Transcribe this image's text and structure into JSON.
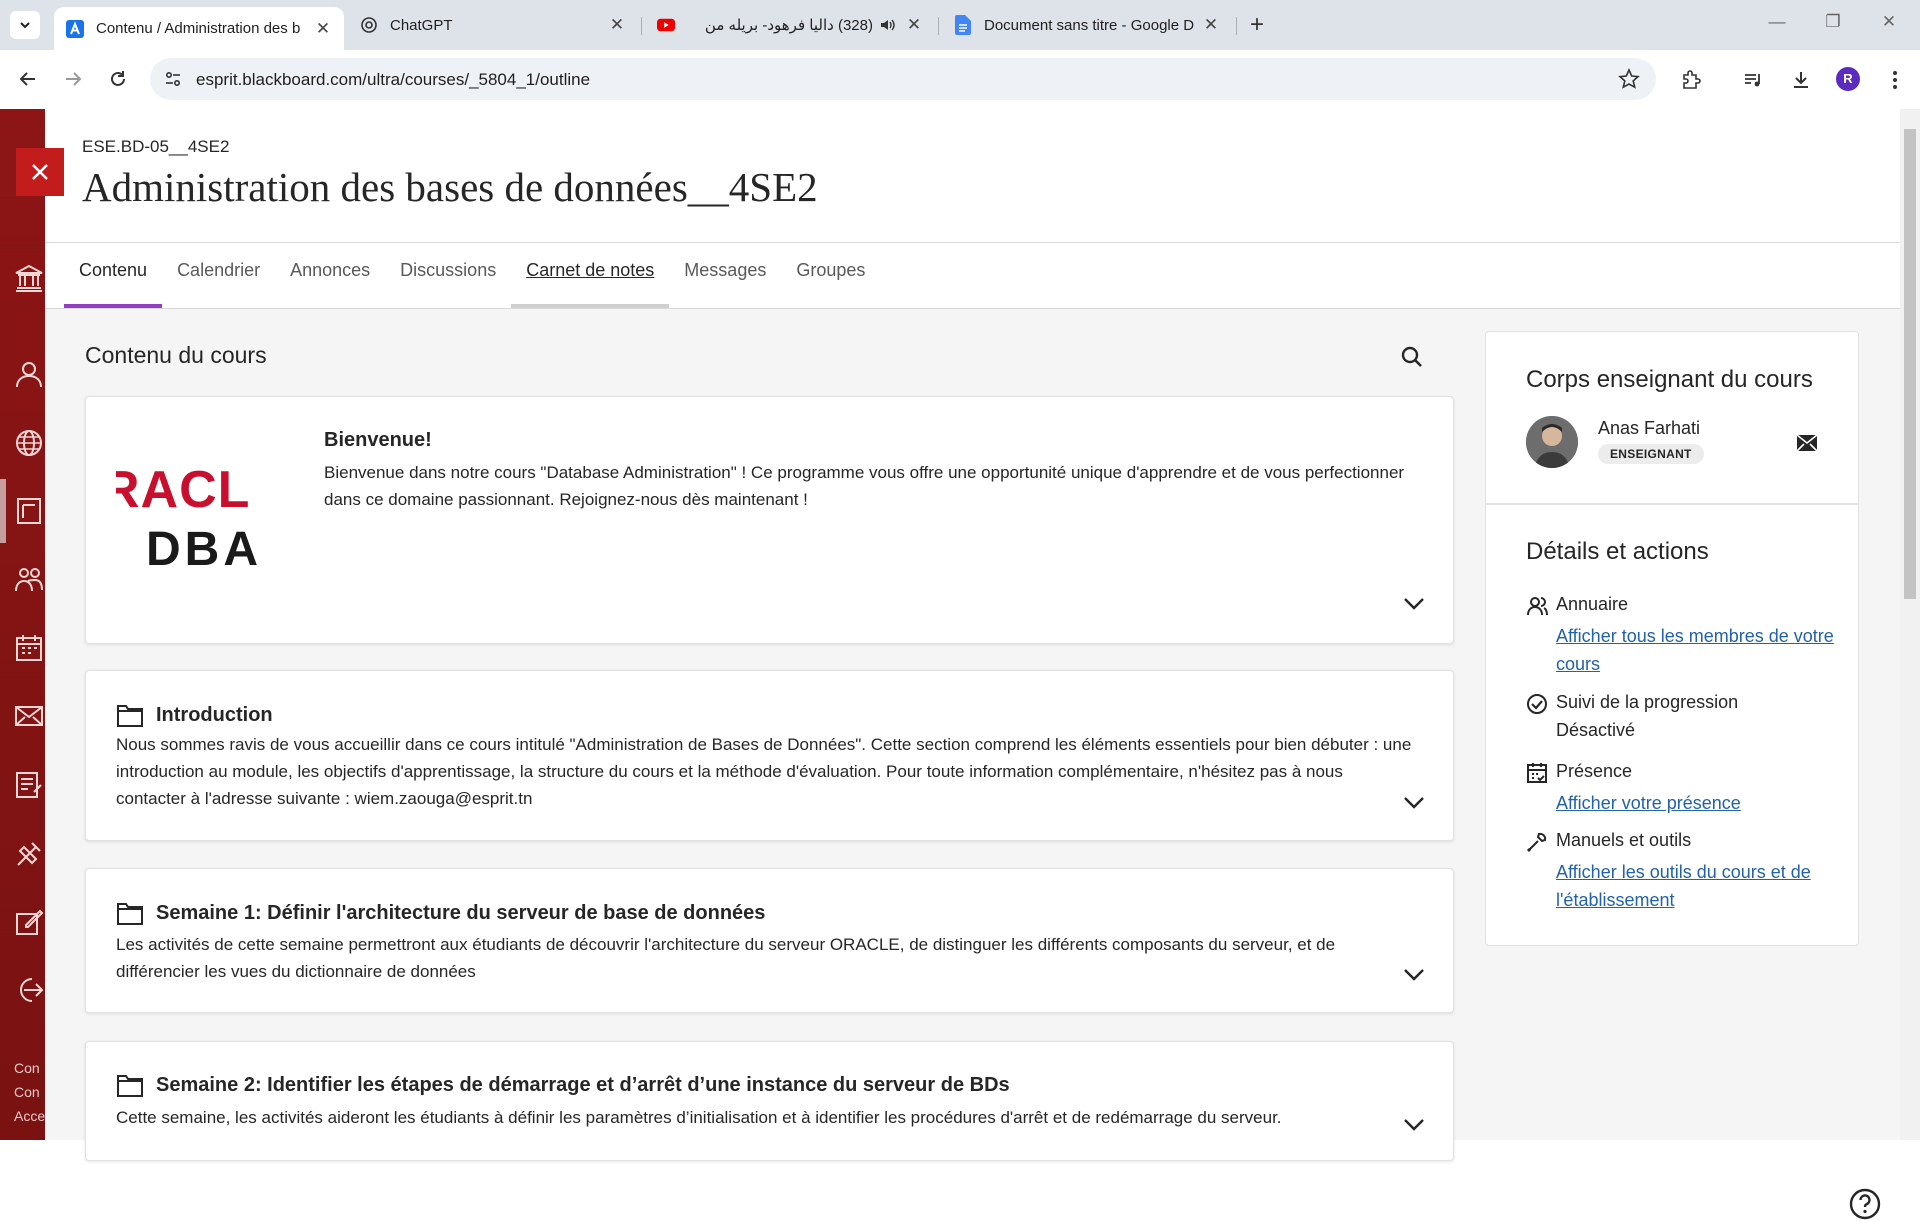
{
  "browser": {
    "tabs": [
      {
        "title": "Contenu / Administration des b",
        "icon": "blackboard-icon",
        "active": true
      },
      {
        "title": "ChatGPT",
        "icon": "chatgpt-icon",
        "active": false
      },
      {
        "title": "(328) داليا فرهود- بريله من",
        "icon": "youtube-icon",
        "active": false
      },
      {
        "title": "Document sans titre - Google D",
        "icon": "google-docs-icon",
        "active": false
      }
    ],
    "url": "esprit.blackboard.com/ultra/courses/_5804_1/outline",
    "profile_initial": "R"
  },
  "course": {
    "code": "ESE.BD-05__4SE2",
    "title": "Administration des bases de données__4SE2"
  },
  "nav": {
    "tabs": [
      "Contenu",
      "Calendrier",
      "Annonces",
      "Discussions",
      "Carnet de notes",
      "Messages",
      "Groupes"
    ]
  },
  "content": {
    "section_title": "Contenu du cours",
    "welcome": {
      "logo_top": "RACL",
      "logo_bottom": "DBA",
      "title": "Bienvenue!",
      "text": "Bienvenue dans notre cours \"Database Administration\" ! Ce programme vous offre une opportunité unique d'apprendre et de vous perfectionner dans ce domaine passionnant. Rejoignez-nous dès maintenant !"
    },
    "folders": [
      {
        "title": "Introduction",
        "text": "Nous sommes ravis de vous accueillir dans ce cours intitulé \"Administration de Bases de Données\". Cette section comprend les éléments essentiels pour bien débuter : une introduction au module, les objectifs d'apprentissage, la structure du cours et la méthode d'évaluation. Pour toute information complémentaire, n'hésitez pas à nous contacter à l'adresse suivante : wiem.zaouga@esprit.tn"
      },
      {
        "title": "Semaine 1: Définir l'architecture du serveur de base de données",
        "text": "Les activités de cette semaine permettront aux étudiants de découvrir l'architecture du serveur ORACLE, de distinguer les différents composants du serveur, et de différencier les vues du dictionnaire de données"
      },
      {
        "title": "Semaine 2: Identifier les étapes de démarrage et d’arrêt d’une instance du serveur de BDs",
        "text": "Cette semaine, les activités aideront les étudiants à définir les paramètres d’initialisation et à identifier les procédures d'arrêt et de redémarrage du serveur."
      }
    ]
  },
  "sidebar": {
    "instructors_title": "Corps enseignant du cours",
    "instructor_name": "Anas Farhati",
    "instructor_role": "ENSEIGNANT",
    "details_title": "Détails et actions",
    "details": [
      {
        "label": "Annuaire",
        "link": "Afficher tous les membres de votre cours",
        "icon": "directory-icon"
      },
      {
        "label": "Suivi de la progression",
        "text": "Désactivé",
        "icon": "progress-check-icon"
      },
      {
        "label": "Présence",
        "link": "Afficher votre présence",
        "icon": "attendance-icon"
      },
      {
        "label": "Manuels et outils",
        "link": "Afficher les outils du cours et de l'établissement",
        "icon": "tools-icon"
      }
    ]
  },
  "rail_footer": [
    "Con",
    "Con",
    "Acce"
  ],
  "colors": {
    "rail": "#8d1515",
    "accent": "#8f3fbf",
    "link": "#2162a8",
    "close": "#c21c1c"
  }
}
